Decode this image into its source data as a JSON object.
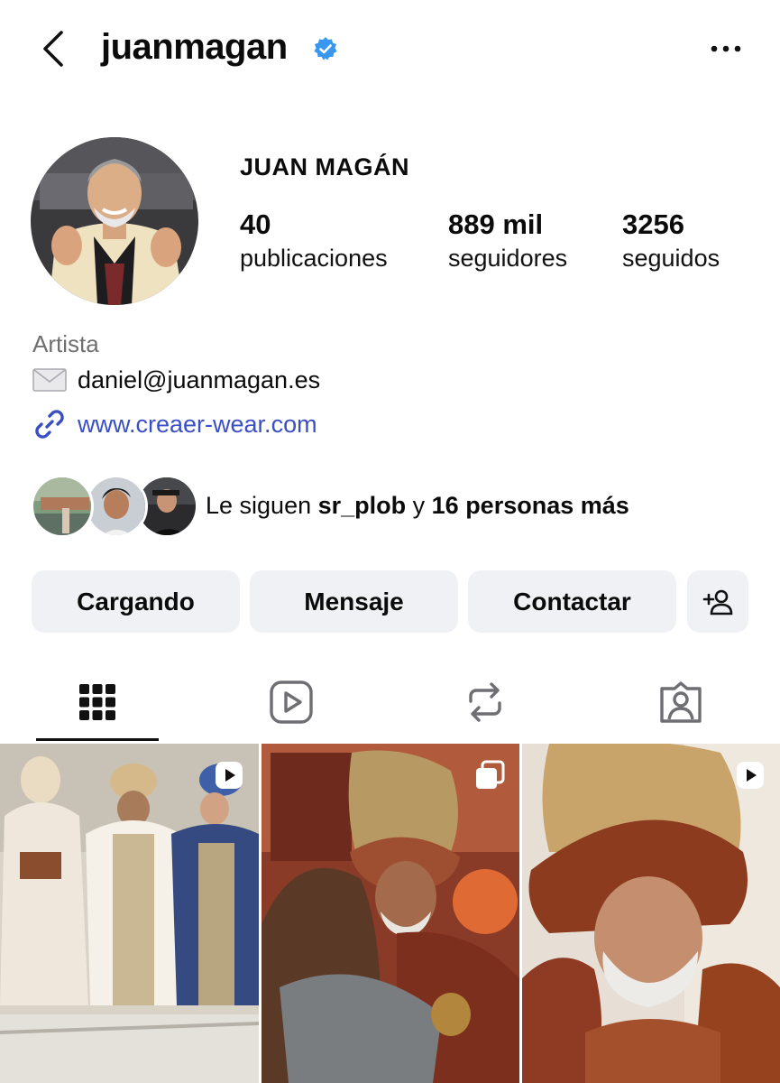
{
  "header": {
    "username": "juanmagan",
    "verified": true,
    "back_icon": "chevron-left-icon",
    "more_icon": "more-horizontal-icon"
  },
  "profile": {
    "display_name": "JUAN MAGÁN",
    "stats": [
      {
        "value": "40",
        "label": "publicaciones"
      },
      {
        "value": "889 mil",
        "label": "seguidores"
      },
      {
        "value": "3256",
        "label": "seguidos"
      }
    ],
    "category": "Artista",
    "email": "daniel@juanmagan.es",
    "link": "www.creaer-wear.com",
    "followed_by": {
      "prefix": "Le siguen ",
      "user": "sr_plob",
      "connector": " y ",
      "others": "16 personas más"
    }
  },
  "actions": {
    "follow_label": "Cargando",
    "message_label": "Mensaje",
    "contact_label": "Contactar",
    "suggest_icon": "add-person-icon"
  },
  "tabs": [
    {
      "name": "grid",
      "icon": "grid-icon",
      "active": true
    },
    {
      "name": "reels",
      "icon": "reels-icon",
      "active": false
    },
    {
      "name": "reposts",
      "icon": "repost-icon",
      "active": false
    },
    {
      "name": "tagged",
      "icon": "tagged-icon",
      "active": false
    }
  ],
  "posts": [
    {
      "type": "reel",
      "badge_icon": "reel-icon"
    },
    {
      "type": "carousel",
      "badge_icon": "carousel-icon"
    },
    {
      "type": "reel",
      "badge_icon": "reel-icon"
    }
  ],
  "colors": {
    "verified": "#3897f0",
    "link": "#3b4fc4",
    "button_bg": "#eff1f4",
    "muted_text": "#6f6f6f"
  }
}
